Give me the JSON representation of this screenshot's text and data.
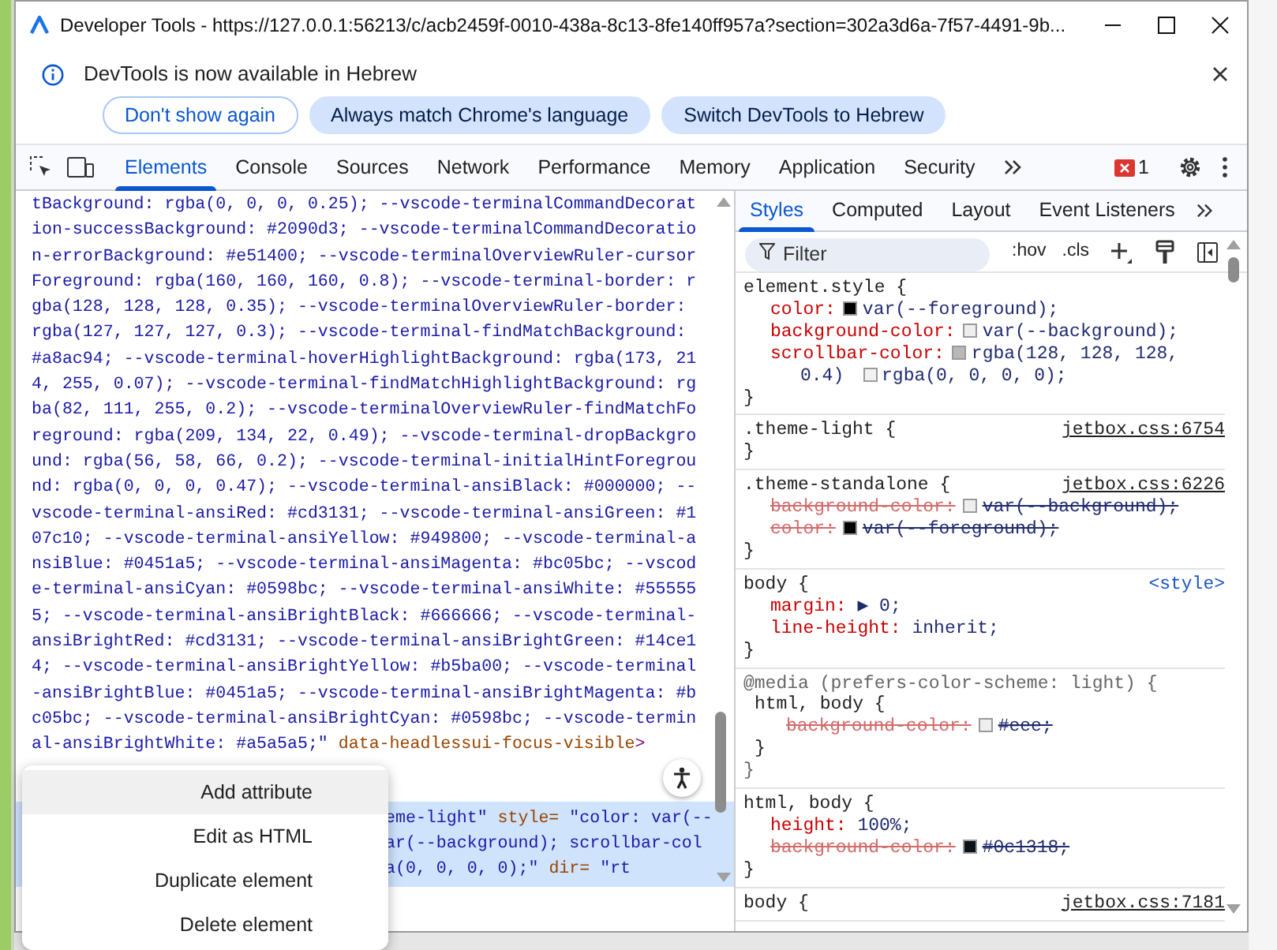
{
  "window": {
    "title": "Developer Tools - https://127.0.0.1:56213/c/acb2459f-0010-438a-8c13-8fe140ff957a?section=302a3d6a-7f57-4491-9b..."
  },
  "infobar": {
    "message": "DevTools is now available in Hebrew",
    "buttons": [
      {
        "label": "Don't show again",
        "kind": "outline"
      },
      {
        "label": "Always match Chrome's language",
        "kind": "filled"
      },
      {
        "label": "Switch DevTools to Hebrew",
        "kind": "filled"
      }
    ]
  },
  "toolbar": {
    "tabs": [
      {
        "label": "Elements",
        "selected": true
      },
      {
        "label": "Console",
        "selected": false
      },
      {
        "label": "Sources",
        "selected": false
      },
      {
        "label": "Network",
        "selected": false
      },
      {
        "label": "Performance",
        "selected": false
      },
      {
        "label": "Memory",
        "selected": false
      },
      {
        "label": "Application",
        "selected": false
      },
      {
        "label": "Security",
        "selected": false
      }
    ],
    "error_count": "1"
  },
  "elements_panel": {
    "lines": [
      {
        "segments": [
          {
            "text": "tBackground: rgba(0, 0, 0, 0.25); --vscode-terminalCommandDecorat",
            "kind": "value"
          }
        ]
      },
      {
        "segments": [
          {
            "text": "ion-successBackground: #2090d3; --vscode-terminalCommandDecoratio",
            "kind": "value"
          }
        ]
      },
      {
        "segments": [
          {
            "text": "n-errorBackground: #e51400; --vscode-terminalOverviewRuler-cursor",
            "kind": "value"
          }
        ]
      },
      {
        "segments": [
          {
            "text": "Foreground: rgba(160, 160, 160, 0.8); --vscode-terminal-border: r",
            "kind": "value"
          }
        ]
      },
      {
        "segments": [
          {
            "text": "gba(128, 128, 128, 0.35); --vscode-terminalOverviewRuler-border:",
            "kind": "value"
          }
        ]
      },
      {
        "segments": [
          {
            "text": "rgba(127, 127, 127, 0.3); --vscode-terminal-findMatchBackground:",
            "kind": "value"
          }
        ]
      },
      {
        "segments": [
          {
            "text": "#a8ac94; --vscode-terminal-hoverHighlightBackground: rgba(173, 21",
            "kind": "value"
          }
        ]
      },
      {
        "segments": [
          {
            "text": "4, 255, 0.07); --vscode-terminal-findMatchHighlightBackground: rg",
            "kind": "value"
          }
        ]
      },
      {
        "segments": [
          {
            "text": "ba(82, 111, 255, 0.2); --vscode-terminalOverviewRuler-findMatchFo",
            "kind": "value"
          }
        ]
      },
      {
        "segments": [
          {
            "text": "reground: rgba(209, 134, 22, 0.49); --vscode-terminal-dropBackgro",
            "kind": "value"
          }
        ]
      },
      {
        "segments": [
          {
            "text": "und: rgba(56, 58, 66, 0.2); --vscode-terminal-initialHintForegrou",
            "kind": "value"
          }
        ]
      },
      {
        "segments": [
          {
            "text": "nd: rgba(0, 0, 0, 0.47); --vscode-terminal-ansiBlack: #000000; --",
            "kind": "value"
          }
        ]
      },
      {
        "segments": [
          {
            "text": "vscode-terminal-ansiRed: #cd3131; --vscode-terminal-ansiGreen: #1",
            "kind": "value"
          }
        ]
      },
      {
        "segments": [
          {
            "text": "07c10; --vscode-terminal-ansiYellow: #949800; --vscode-terminal-a",
            "kind": "value"
          }
        ]
      },
      {
        "segments": [
          {
            "text": "nsiBlue: #0451a5; --vscode-terminal-ansiMagenta: #bc05bc; --vscod",
            "kind": "value"
          }
        ]
      },
      {
        "segments": [
          {
            "text": "e-terminal-ansiCyan: #0598bc; --vscode-terminal-ansiWhite: #55555",
            "kind": "value"
          }
        ]
      },
      {
        "segments": [
          {
            "text": "5; --vscode-terminal-ansiBrightBlack: #666666; --vscode-terminal-",
            "kind": "value"
          }
        ]
      },
      {
        "segments": [
          {
            "text": "ansiBrightRed: #cd3131; --vscode-terminal-ansiBrightGreen: #14ce1",
            "kind": "value"
          }
        ]
      },
      {
        "segments": [
          {
            "text": "4; --vscode-terminal-ansiBrightYellow: #b5ba00; --vscode-terminal",
            "kind": "value"
          }
        ]
      },
      {
        "segments": [
          {
            "text": "-ansiBrightBlue: #0451a5; --vscode-terminal-ansiBrightMagenta: #b",
            "kind": "value"
          }
        ]
      },
      {
        "segments": [
          {
            "text": "c05bc; --vscode-terminal-ansiBrightCyan: #0598bc; --vscode-termin",
            "kind": "value"
          }
        ]
      },
      {
        "segments": [
          {
            "text": "al-ansiBrightWhite: #a5a5a5;\"",
            "kind": "value"
          },
          {
            "text": "data-headlessui-focus-visible",
            "kind": "attr"
          },
          {
            "text": ">",
            "kind": "tag"
          }
        ]
      }
    ],
    "selected_lines": [
      {
        "segments": [
          {
            "text": "eme-light\"",
            "kind": "value"
          },
          {
            "text": "style=",
            "kind": "attr"
          },
          {
            "text": "\"color: var(--",
            "kind": "value"
          }
        ]
      },
      {
        "segments": [
          {
            "text": "ar(--background); scrollbar-col",
            "kind": "value"
          }
        ]
      },
      {
        "segments": [
          {
            "text": "a(0, 0, 0, 0);\"",
            "kind": "value"
          },
          {
            "text": "dir=",
            "kind": "attr"
          },
          {
            "text": "\"rt",
            "kind": "value"
          }
        ]
      }
    ]
  },
  "context_menu": {
    "items": [
      {
        "label": "Add attribute",
        "selected": true
      },
      {
        "label": "Edit as HTML",
        "selected": false
      },
      {
        "label": "Duplicate element",
        "selected": false
      },
      {
        "label": "Delete element",
        "selected": false
      }
    ]
  },
  "styles_pane": {
    "tabs": [
      {
        "label": "Styles",
        "selected": true
      },
      {
        "label": "Computed",
        "selected": false
      },
      {
        "label": "Layout",
        "selected": false
      },
      {
        "label": "Event Listeners",
        "selected": false
      }
    ],
    "filter": {
      "placeholder": "Filter"
    },
    "toggles": [
      ":hov",
      ".cls"
    ],
    "rules": [
      {
        "selector": "element.style {",
        "decls": [
          {
            "name": "color:",
            "parts": [
              {
                "color": "#000000",
                "text": "var(--foreground);"
              }
            ],
            "struck": false
          },
          {
            "name": "background-color:",
            "parts": [
              {
                "color": "#eeeeee",
                "text": "var(--background);"
              }
            ],
            "struck": false
          },
          {
            "name": "scrollbar-color:",
            "parts": [
              {
                "color": "#b8b8b8",
                "text": "rgba(128, 128, 128,"
              },
              {
                "text": "0.4)"
              },
              {
                "color": "#f2f2f2",
                "text": "rgba(0, 0, 0, 0);"
              }
            ],
            "struck": false
          }
        ],
        "close": "}"
      },
      {
        "selector": ".theme-light {",
        "source": {
          "text": "jetbox.css:6754",
          "kind": "file"
        },
        "close": "}"
      },
      {
        "selector": ".theme-standalone {",
        "source": {
          "text": "jetbox.css:6226",
          "kind": "file"
        },
        "decls": [
          {
            "name": "background-color:",
            "parts": [
              {
                "color": "#eeeeee",
                "text": "var(--background);"
              }
            ],
            "struck": true
          },
          {
            "name": "color:",
            "parts": [
              {
                "color": "#000000",
                "text": "var(--foreground);"
              }
            ],
            "struck": true
          }
        ],
        "close": "}"
      },
      {
        "selector": "body {",
        "source": {
          "text": "<style>",
          "kind": "inline"
        },
        "decls": [
          {
            "name": "margin:",
            "parts": [
              {
                "text": "▶ 0;"
              }
            ],
            "struck": false
          },
          {
            "name": "line-height:",
            "parts": [
              {
                "text": "inherit;"
              }
            ],
            "struck": false
          }
        ],
        "close": "}"
      },
      {
        "media": "@media (prefers-color-scheme: light) {",
        "selector": "html, body {",
        "decls": [
          {
            "name": "background-color:",
            "parts": [
              {
                "color": "#eeeeee",
                "text": "#eee;"
              }
            ],
            "struck": true
          }
        ],
        "close": "}",
        "media_close": "}"
      },
      {
        "selector": "html, body {",
        "decls": [
          {
            "name": "height:",
            "parts": [
              {
                "text": "100%;"
              }
            ],
            "struck": false
          },
          {
            "name": "background-color:",
            "parts": [
              {
                "color": "#0c1318",
                "text": "#0c1318;"
              }
            ],
            "struck": true
          }
        ],
        "close": "}"
      },
      {
        "selector": "body {",
        "source": {
          "text": "jetbox.css:7181",
          "kind": "file"
        }
      }
    ]
  }
}
